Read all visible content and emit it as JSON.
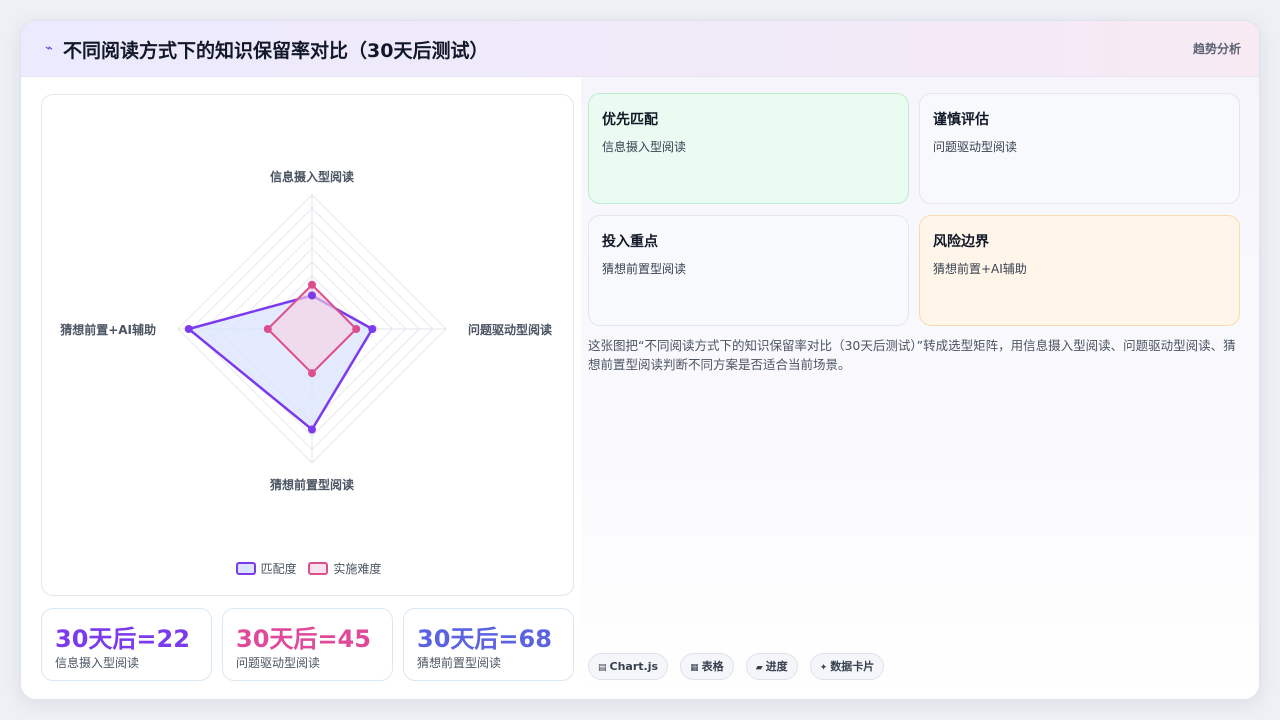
{
  "header": {
    "icon": "trend-line-icon",
    "title": "不同阅读方式下的知识保留率对比（30天后测试）",
    "tag": "趋势分析"
  },
  "chart_data": {
    "type": "radar",
    "axes": [
      "信息摄入型阅读",
      "问题驱动型阅读",
      "猜想前置型阅读",
      "猜想前置+AI辅助"
    ],
    "range": [
      0,
      100
    ],
    "grid": true,
    "legend_position": "bottom",
    "series": [
      {
        "name": "匹配度",
        "values": [
          25,
          45,
          75,
          92
        ],
        "color": "#7c3aed",
        "fill": "#dbe4ff"
      },
      {
        "name": "实施难度",
        "values": [
          33,
          33,
          33,
          33
        ],
        "color": "#db4f8e",
        "fill": "#f5d2e2"
      }
    ]
  },
  "stats": [
    {
      "value": "30天后=22",
      "label": "信息摄入型阅读",
      "color": "#7c3aed"
    },
    {
      "value": "30天后=45",
      "label": "问题驱动型阅读",
      "color": "#e0489a"
    },
    {
      "value": "30天后=68",
      "label": "猜想前置型阅读",
      "color": "#5b63e0"
    }
  ],
  "quadrants": [
    {
      "title": "优先匹配",
      "value": "信息摄入型阅读",
      "bg": "#eafbf2",
      "border": "#bdeccf"
    },
    {
      "title": "谨慎评估",
      "value": "问题驱动型阅读",
      "bg": "#f8f9fc",
      "border": "#e2e6f0"
    },
    {
      "title": "投入重点",
      "value": "猜想前置型阅读",
      "bg": "#f8f9fc",
      "border": "#e2e6f0"
    },
    {
      "title": "风险边界",
      "value": "猜想前置+AI辅助",
      "bg": "#fff6e9",
      "border": "#f5dcb0"
    }
  ],
  "description": "这张图把“不同阅读方式下的知识保留率对比（30天后测试）”转成选型矩阵，用信息摄入型阅读、问题驱动型阅读、猜想前置型阅读判断不同方案是否适合当前场景。",
  "chips": [
    {
      "icon": "chart-icon",
      "glyph": "▤",
      "label": "Chart.js"
    },
    {
      "icon": "table-icon",
      "glyph": "▦",
      "label": "表格"
    },
    {
      "icon": "progress-icon",
      "glyph": "▰",
      "label": "进度"
    },
    {
      "icon": "sparkle-icon",
      "glyph": "✦",
      "label": "数据卡片"
    }
  ]
}
